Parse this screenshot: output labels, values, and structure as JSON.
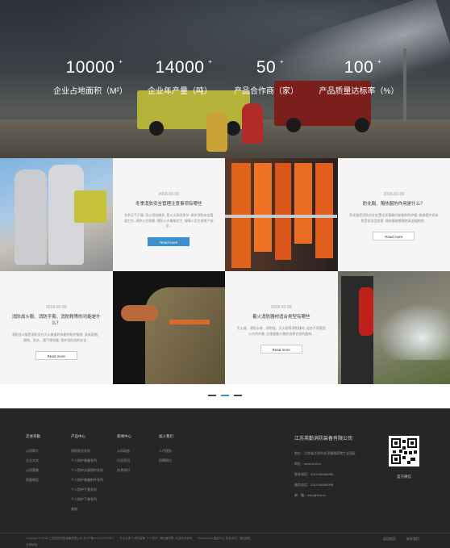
{
  "stats": [
    {
      "value": "10000",
      "label": "企业占地面积（M²）"
    },
    {
      "value": "14000",
      "label": "企业年产量（吨）"
    },
    {
      "value": "50",
      "label": "产品合作商（家）"
    },
    {
      "value": "100",
      "label": "产品质量达标率（%）"
    }
  ],
  "stat_plus": "+",
  "news": [
    {
      "date": "2018-02-09",
      "title": "冬季消防安全管理注意事项有哪些",
      "desc": "冬季天气干燥, 用火用电增多, 是火灾高发季节, 做好消防安全管理工作, 消除火灾隐患, 预防火灾事故发生, 保障人民生命财产安全...",
      "button": "Read more"
    },
    {
      "date": "2018-02-09",
      "title": "防化服、隔热服的作用是什么？",
      "desc": "防化服是消防员在处置化学事故时穿着的防护服, 能够保护身体免受化学品伤害, 隔热服能够隔绝高温辐射热...",
      "button": "Read more"
    },
    {
      "date": "2018-02-09",
      "title": "消防战斗服、消防手套、消防靴等的功能是什么？",
      "desc": "消防战斗服是消防员在灭火救援时穿着的防护服装, 具有阻燃、隔热、防水、透气等性能, 保护消防员的安全...",
      "button": "Read more"
    },
    {
      "date": "2018-02-09",
      "title": "着火消防器材适合类型有哪些",
      "desc": "灭火器、消防水带、消防栓、灭火毯等消防器材, 适合不同类型火灾的扑救, 应根据着火物质选择合适的器材...",
      "button": "Read more"
    }
  ],
  "footer": {
    "columns": [
      {
        "head": "走进英勤",
        "links": [
          "公司简介",
          "企业文化",
          "公司荣誉",
          "质量保证"
        ]
      },
      {
        "head": "产品中心",
        "links": [
          "消防防化系列",
          "个人防护装备系列",
          "个人防护头部保护系列",
          "个人防护装备附件系列",
          "个人防护手套系列",
          "个人防护下装系列",
          "其他"
        ]
      },
      {
        "head": "新闻中心",
        "links": [
          "公司动态",
          "行业资讯",
          "技术知识"
        ]
      },
      {
        "head": "加入我们",
        "links": [
          "人才理念",
          "招聘职位"
        ]
      }
    ],
    "company": {
      "name": "江苏英勤消防装备有限公司",
      "address": "地址：江苏省江阴市长泾镇张家港工业园区",
      "website": "网址：www.5vd.cn",
      "phone1": "联系电话：2014-86449095",
      "phone2": "服务电话：2014-86449098",
      "email": "邮　箱：dxfu@5vd.cn"
    },
    "qr_label": "官方微信",
    "copyright": "Copyright © 2018 江苏英勤消防装备有限公司 苏ICP备XXXXXXXX号-1　　专业从事于消防装备, 个人防护, 消防器材等, 欢迎来电咨询　　Powered by 建站平台 技术支持：建站团队",
    "copyright2": "友情链接：",
    "bottom_links": [
      "返回首页",
      "联系我们"
    ]
  }
}
